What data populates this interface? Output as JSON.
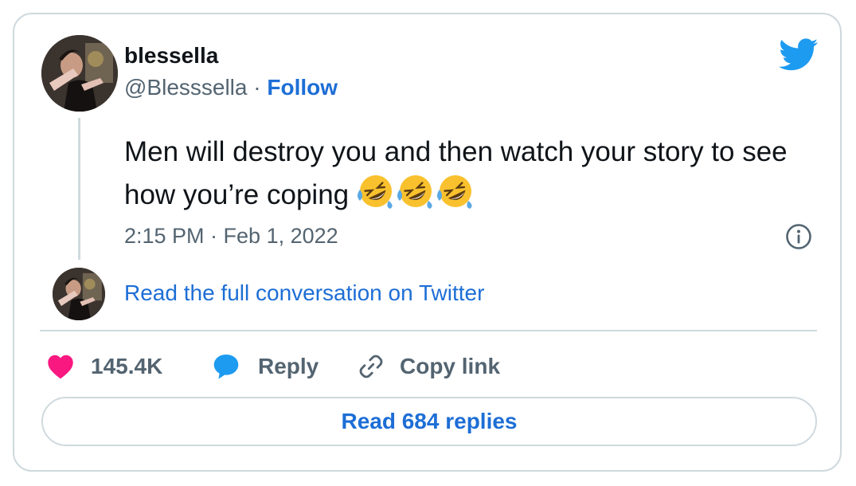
{
  "author": {
    "display_name": "blessella",
    "handle": "@Blesssella",
    "separator": "·",
    "follow_label": "Follow"
  },
  "tweet": {
    "text": "Men will destroy you and then watch your story to see how you’re coping",
    "emoji": [
      "rolling-on-the-floor-laughing",
      "rolling-on-the-floor-laughing",
      "rolling-on-the-floor-laughing"
    ],
    "timestamp": "2:15 PM · Feb 1, 2022"
  },
  "conversation_link": "Read the full conversation on Twitter",
  "actions": {
    "likes": "145.4K",
    "reply_label": "Reply",
    "copy_link_label": "Copy link"
  },
  "read_replies_label": "Read 684 replies",
  "icons": {
    "brand": "twitter-bird-icon",
    "info": "info-icon",
    "like": "heart-icon",
    "reply": "speech-bubble-icon",
    "copy": "link-icon"
  },
  "colors": {
    "twitter_blue": "#1d9bf0",
    "link_blue": "#1d6ed6",
    "heart_pink": "#f91880",
    "text_primary": "#0f1419",
    "text_secondary": "#536471",
    "border": "#cfd9de"
  }
}
